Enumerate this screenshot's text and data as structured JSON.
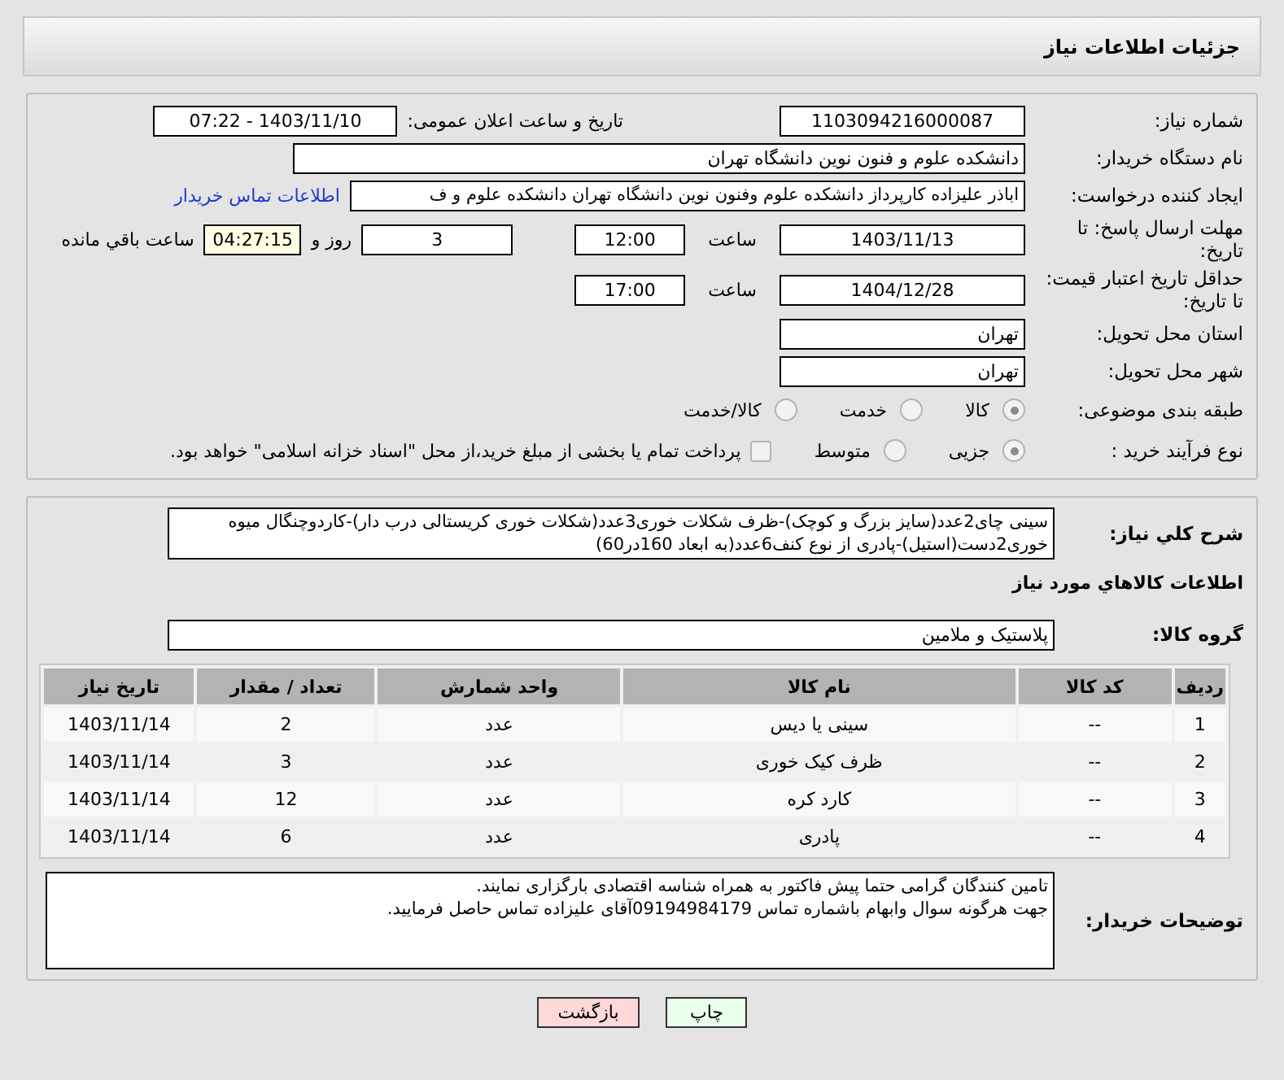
{
  "header": {
    "title": "جزئیات اطلاعات نیاز"
  },
  "need_number": {
    "label": "شماره نیاز:",
    "value": "1103094216000087"
  },
  "announce": {
    "label": "تاریخ و ساعت اعلان عمومی:",
    "value": "1403/11/10 - 07:22"
  },
  "buyer_org": {
    "label": "نام دستگاه خریدار:",
    "value": "دانشکده علوم و فنون نوین دانشگاه تهران"
  },
  "requester": {
    "label": "ایجاد کننده درخواست:",
    "value": "اباذر علیزاده کارپرداز دانشکده علوم وفنون نوین دانشگاه تهران دانشکده علوم و ف",
    "link": "اطلاعات تماس خریدار"
  },
  "reply_deadline": {
    "label": "مهلت ارسال پاسخ: تا تاریخ:",
    "date": "1403/11/13",
    "time_label": "ساعت",
    "time": "12:00",
    "days": "3",
    "days_label": "روز و",
    "remaining": "04:27:15",
    "remaining_label": "ساعت باقي مانده"
  },
  "price_validity": {
    "label": "حداقل تاریخ اعتبار قیمت: تا تاریخ:",
    "date": "1404/12/28",
    "time_label": "ساعت",
    "time": "17:00"
  },
  "province": {
    "label": "استان محل تحویل:",
    "value": "تهران"
  },
  "city": {
    "label": "شهر محل تحویل:",
    "value": "تهران"
  },
  "category": {
    "label": "طبقه بندی موضوعی:",
    "options": [
      {
        "label": "کالا",
        "selected": true
      },
      {
        "label": "خدمت",
        "selected": false
      },
      {
        "label": "کالا/خدمت",
        "selected": false
      }
    ]
  },
  "process": {
    "label": "نوع فرآیند خرید :",
    "options": [
      {
        "label": "جزیی",
        "selected": true
      },
      {
        "label": "متوسط",
        "selected": false
      }
    ],
    "payment": {
      "checked": false,
      "text": "پرداخت تمام یا بخشی از مبلغ خرید،از محل \"اسناد خزانه اسلامی\" خواهد بود."
    }
  },
  "description": {
    "label": "شرح کلي نياز:",
    "text": "سینی چای2عدد(سایز بزرگ و کوچک)-ظرف شکلات خوری3عدد(شکلات خوری کریستالی درب دار)-کاردوچنگال میوه خوری2دست(استیل)-پادری از نوع کنف6عدد(به ابعاد 160در60)"
  },
  "goods_heading": "اطلاعات کالاهاي مورد نياز",
  "goods_group": {
    "label": "گروه کالا:",
    "value": "پلاستیک و ملامین"
  },
  "table": {
    "columns": [
      "ردیف",
      "کد کالا",
      "نام کالا",
      "واحد شمارش",
      "تعداد / مقدار",
      "تاریخ نیاز"
    ],
    "rows": [
      [
        "1",
        "--",
        "سینی یا دیس",
        "عدد",
        "2",
        "1403/11/14"
      ],
      [
        "2",
        "--",
        "ظرف کیک خوری",
        "عدد",
        "3",
        "1403/11/14"
      ],
      [
        "3",
        "--",
        "کارد کره",
        "عدد",
        "12",
        "1403/11/14"
      ],
      [
        "4",
        "--",
        "پادری",
        "عدد",
        "6",
        "1403/11/14"
      ]
    ]
  },
  "buyer_notes": {
    "label": "توضیحات خریدار:",
    "text": "تامین کنندگان گرامی حتما پیش فاکتور به همراه شناسه اقتصادی بارگزاری نمایند.\nجهت هرگونه سوال وابهام باشماره تماس 09194984179آقای علیزاده تماس حاصل فرمایید."
  },
  "buttons": [
    {
      "label": "چاپ",
      "kind": "print"
    },
    {
      "label": "بازگشت",
      "kind": "back"
    }
  ]
}
